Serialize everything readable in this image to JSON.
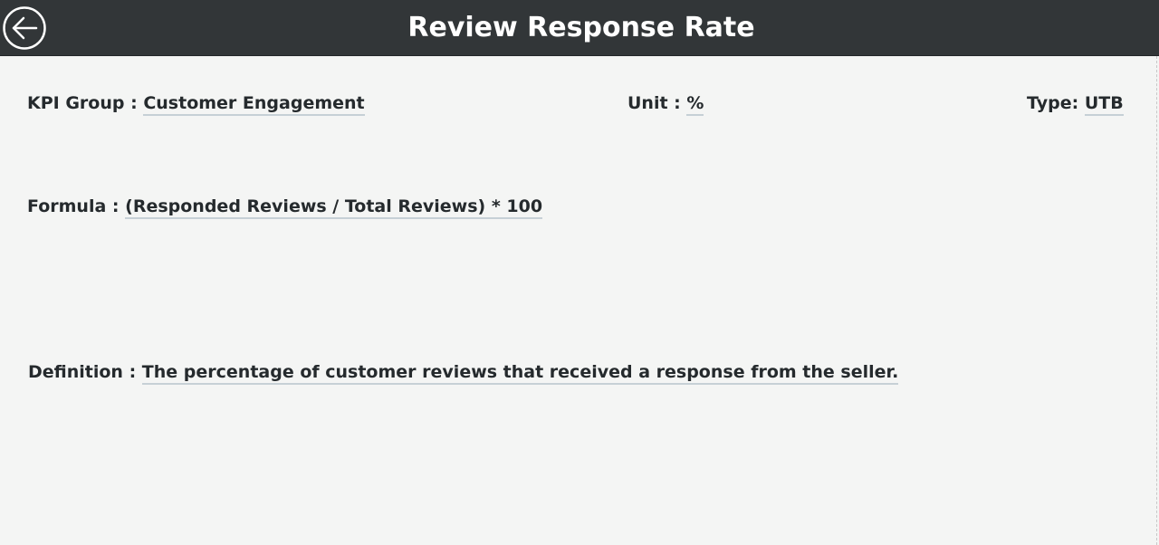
{
  "header": {
    "title": "Review Response Rate",
    "back_icon": "arrow-left-circle-icon"
  },
  "fields": {
    "kpi_group": {
      "label": "KPI Group :",
      "value": "Customer Engagement"
    },
    "unit": {
      "label": "Unit :",
      "value": "%"
    },
    "type": {
      "label": "Type:",
      "value": "UTB"
    },
    "formula": {
      "label": "Formula :",
      "value": "(Responded Reviews / Total Reviews) * 100"
    },
    "definition": {
      "label": "Definition :",
      "value": "The percentage of customer reviews that received a response from the seller."
    }
  },
  "colors": {
    "header_bg": "#323638",
    "page_bg": "#f4f5f4",
    "text": "#252a2d",
    "underline": "#c6d0d6"
  }
}
